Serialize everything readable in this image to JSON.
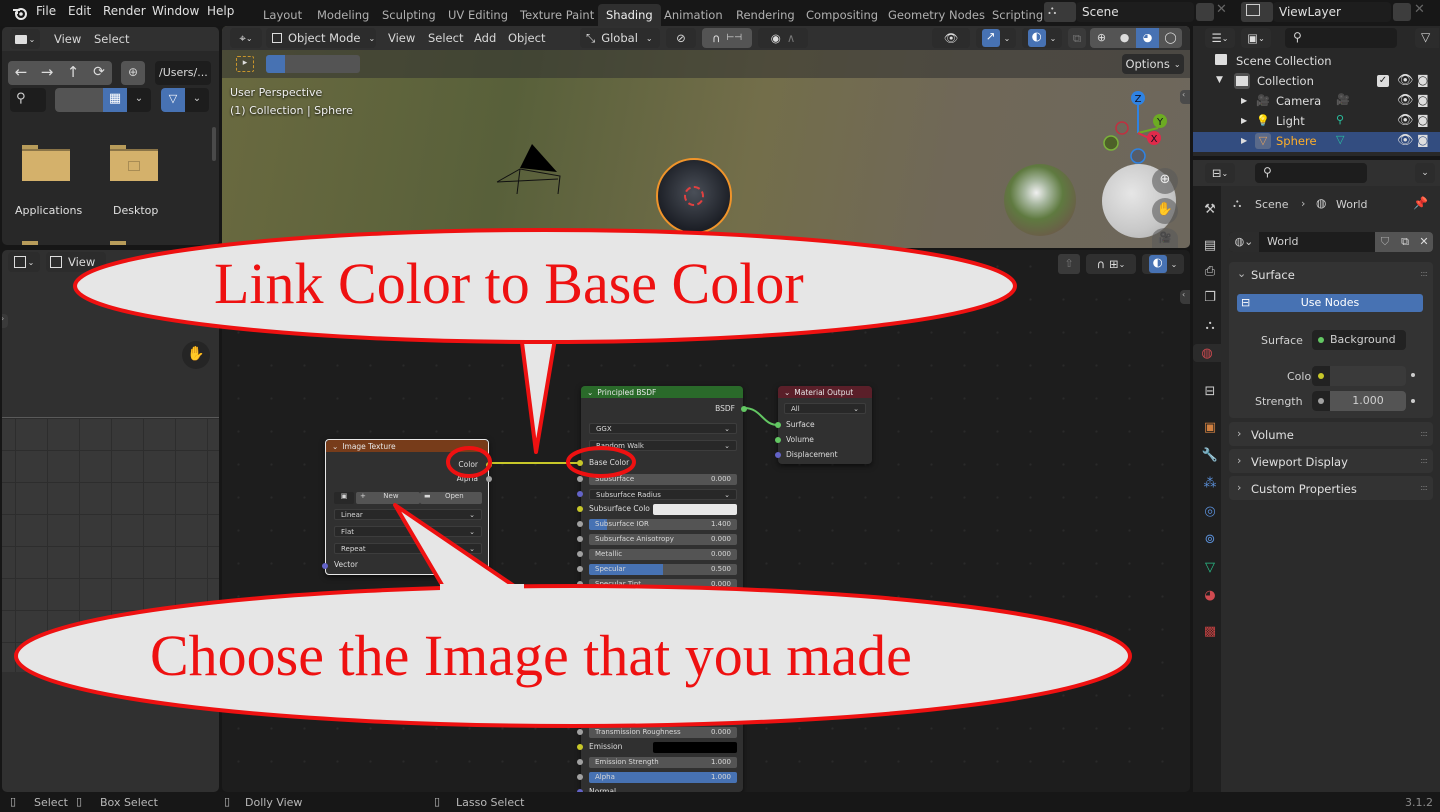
{
  "app": {
    "version": "3.1.2"
  },
  "menu": [
    "File",
    "Edit",
    "Render",
    "Window",
    "Help"
  ],
  "workspaces": [
    "Layout",
    "Modeling",
    "Sculpting",
    "UV Editing",
    "Texture Paint",
    "Shading",
    "Animation",
    "Rendering",
    "Compositing",
    "Geometry Nodes",
    "Scripting"
  ],
  "active_workspace": "Shading",
  "scene": {
    "name": "Scene",
    "view_layer": "ViewLayer"
  },
  "file_browser": {
    "menus": [
      "View",
      "Select"
    ],
    "path": "/Users/...",
    "items": [
      {
        "name": "Applications",
        "icon": "folder-icon"
      },
      {
        "name": "Desktop",
        "icon": "folder-desktop-icon"
      }
    ]
  },
  "image_editor": {
    "view_label": "View"
  },
  "viewport": {
    "mode": "Object Mode",
    "menus": [
      "View",
      "Select",
      "Add",
      "Object"
    ],
    "transform_orientation": "Global",
    "options_label": "Options",
    "overlay_line1": "User Perspective",
    "overlay_line2": "(1) Collection | Sphere",
    "gizmo": {
      "z": "Z",
      "y": "Y",
      "x": "X"
    }
  },
  "outliner": {
    "root": "Scene Collection",
    "collection": "Collection",
    "objects": [
      {
        "name": "Camera",
        "icon": "camera-icon",
        "data_icon": "camera-data-icon",
        "selected": false
      },
      {
        "name": "Light",
        "icon": "light-icon",
        "data_icon": "light-data-icon",
        "selected": false
      },
      {
        "name": "Sphere",
        "icon": "mesh-icon",
        "data_icon": "mesh-data-icon",
        "selected": true
      }
    ]
  },
  "properties": {
    "breadcrumb": [
      "Scene",
      "World"
    ],
    "world_name": "World",
    "panels": {
      "surface": {
        "title": "Surface",
        "use_nodes": "Use Nodes",
        "surface_label": "Surface",
        "surface_value": "Background",
        "color_label": "Color",
        "strength_label": "Strength",
        "strength_value": "1.000"
      },
      "collapsed": [
        "Volume",
        "Viewport Display",
        "Custom Properties"
      ]
    }
  },
  "node_editor": {
    "image_texture": {
      "title": "Image Texture",
      "outputs": [
        "Color",
        "Alpha"
      ],
      "new_label": "New",
      "open_label": "Open",
      "interpolation": "Linear",
      "projection": "Flat",
      "extension": "Repeat",
      "inputs": [
        "Vector"
      ]
    },
    "principled": {
      "title": "Principled BSDF",
      "output": "BSDF",
      "distribution": "GGX",
      "subsurface_method": "Random Walk",
      "base_color": "Base Color",
      "rows": [
        {
          "label": "Subsurface",
          "value": "0.000",
          "fill": 0
        },
        {
          "label": "Subsurface Radius",
          "value": "",
          "dropdown": true
        },
        {
          "label": "Subsurface Colo",
          "value": "",
          "color": "#e8e8e8"
        },
        {
          "label": "Subsurface IOR",
          "value": "1.400",
          "fill": 0.12
        },
        {
          "label": "Subsurface Anisotropy",
          "value": "0.000",
          "fill": 0
        },
        {
          "label": "Metallic",
          "value": "0.000",
          "fill": 0
        },
        {
          "label": "Specular",
          "value": "0.500",
          "fill": 0.5
        },
        {
          "label": "Specular Tint",
          "value": "0.000",
          "fill": 0
        }
      ],
      "bottom_rows": [
        {
          "label": "Transmission Roughness",
          "value": "0.000"
        },
        {
          "label": "Emission",
          "value": "",
          "color": "#000000"
        },
        {
          "label": "Emission Strength",
          "value": "1.000"
        },
        {
          "label": "Alpha",
          "value": "1.000",
          "fill": 1.0
        },
        {
          "label": "Normal",
          "value": ""
        }
      ]
    },
    "material_output": {
      "title": "Material Output",
      "target": "All",
      "inputs": [
        "Surface",
        "Volume",
        "Displacement"
      ]
    }
  },
  "callouts": {
    "top": "Link Color to Base Color",
    "bottom": "Choose the Image that you made"
  },
  "statusbar": {
    "select": "Select",
    "box_select": "Box Select",
    "dolly_view": "Dolly View",
    "lasso_select": "Lasso Select"
  },
  "colors": {
    "accent": "#4772b3",
    "selection_text": "#ffaf29",
    "callout_red": "#ee1111",
    "node_texture_header": "#773c1a",
    "node_shader_header": "#2a6a2a",
    "node_output_header": "#5a1f29"
  }
}
